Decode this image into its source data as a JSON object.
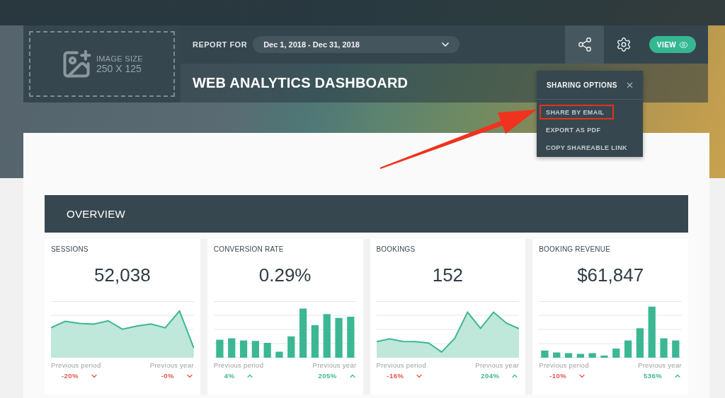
{
  "header": {
    "logo_placeholder": {
      "label": "IMAGE SIZE",
      "size": "250 X 125"
    },
    "report_for_label": "REPORT FOR",
    "date_range": {
      "value": "Dec 1, 2018 - Dec 31, 2018"
    },
    "toolbar": [
      {
        "kind": "share",
        "active": true
      },
      {
        "kind": "settings",
        "active": false
      }
    ],
    "view_button": {
      "label": "VIEW"
    },
    "title": "WEB ANALYTICS DASHBOARD"
  },
  "sharing_menu": {
    "title": "SHARING OPTIONS",
    "items": [
      {
        "label": "SHARE BY EMAIL",
        "highlighted": true
      },
      {
        "label": "EXPORT AS PDF",
        "highlighted": false
      },
      {
        "label": "COPY SHAREABLE LINK",
        "highlighted": false
      }
    ]
  },
  "overview": {
    "title": "OVERVIEW",
    "metrics": [
      {
        "title": "SESSIONS",
        "value": "52,038",
        "kind": "area",
        "comparisons": [
          {
            "label": "Previous period",
            "change": "-20%",
            "kind": "down"
          },
          {
            "label": "Previous year",
            "change": "-0%",
            "kind": "down"
          }
        ]
      },
      {
        "title": "CONVERSION RATE",
        "value": "0.29%",
        "kind": "bar",
        "comparisons": [
          {
            "label": "Previous period",
            "change": "4%",
            "kind": "up"
          },
          {
            "label": "Previous year",
            "change": "205%",
            "kind": "up"
          }
        ]
      },
      {
        "title": "BOOKINGS",
        "value": "152",
        "kind": "area",
        "comparisons": [
          {
            "label": "Previous period",
            "change": "-16%",
            "kind": "down"
          },
          {
            "label": "Previous year",
            "change": "204%",
            "kind": "up"
          }
        ]
      },
      {
        "title": "BOOKING REVENUE",
        "value": "$61,847",
        "kind": "bar",
        "comparisons": [
          {
            "label": "Previous period",
            "change": "-10%",
            "kind": "down"
          },
          {
            "label": "Previous year",
            "change": "536%",
            "kind": "up"
          }
        ]
      }
    ]
  }
}
